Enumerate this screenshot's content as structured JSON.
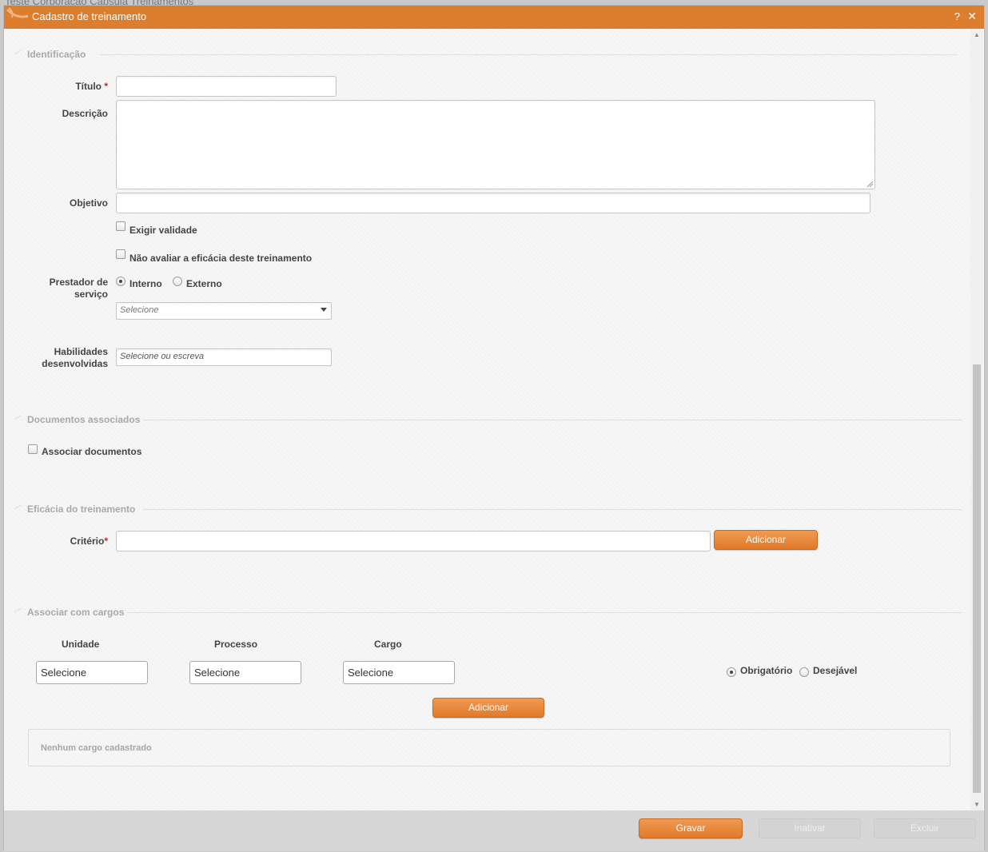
{
  "background_title": "Teste Corporação Capsula Treinamentos",
  "dialog": {
    "title": "Cadastro de treinamento",
    "help": "?",
    "close": "✕"
  },
  "sections": {
    "identificacao": "Identificação",
    "documentos": "Documentos associados",
    "eficacia": "Eficácia do treinamento",
    "cargos": "Associar com cargos"
  },
  "form": {
    "titulo_label": "Título",
    "required_mark": "*",
    "descricao_label": "Descrição",
    "objetivo_label": "Objetivo",
    "exigir_validade": "Exigir validade",
    "nao_avaliar": "Não avaliar a eficácia deste treinamento",
    "prestador_label_1": "Prestador de",
    "prestador_label_2": "serviço",
    "interno": "Interno",
    "externo": "Externo",
    "prestador_select_placeholder": "Selecione",
    "habilidades_label_1": "Habilidades",
    "habilidades_label_2": "desenvolvidas",
    "habilidades_placeholder": "Selecione ou escreva",
    "associar_documentos": "Associar documentos",
    "criterio_label": "Critério",
    "adicionar_criterio": "Adicionar"
  },
  "cargos": {
    "unidade_header": "Unidade",
    "processo_header": "Processo",
    "cargo_header": "Cargo",
    "unidade_value": "Selecione",
    "processo_value": "Selecione",
    "cargo_value": "Selecione",
    "obrigatorio": "Obrigatório",
    "desejavel": "Desejável",
    "adicionar": "Adicionar",
    "empty_message": "Nenhum cargo cadastrado"
  },
  "footer": {
    "gravar": "Gravar",
    "inativar": "Inativar",
    "excluir": "Excluir"
  },
  "colors": {
    "accent": "#dd7d2e",
    "button": "#e8873a",
    "required": "#cc2222"
  }
}
